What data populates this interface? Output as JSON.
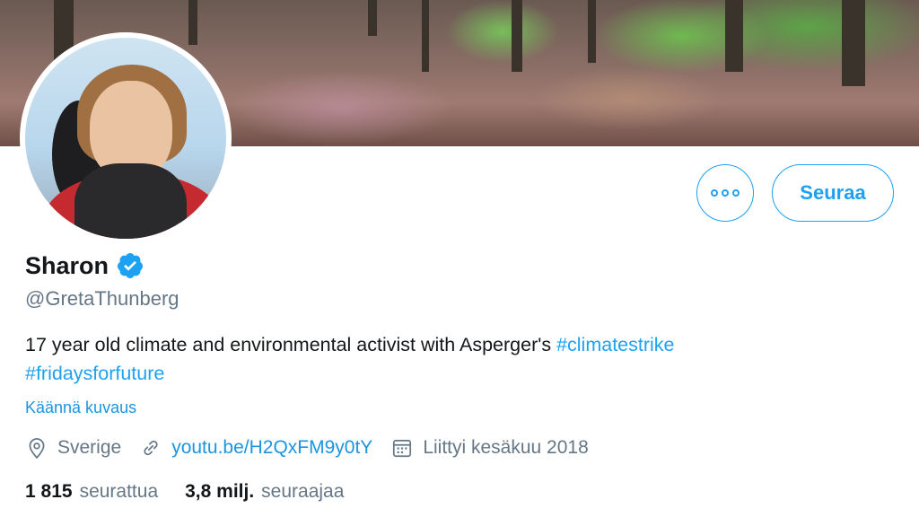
{
  "profile": {
    "name": "Sharon",
    "handle": "@GretaThunberg",
    "bio_text": "17 year old climate and environmental activist with Asperger's ",
    "hashtag_1": "#climatestrike",
    "hashtag_2": "#fridaysforfuture",
    "translate_label": "Käännä kuvaus",
    "location": "Sverige",
    "website": "youtu.be/H2QxFM9y0tY",
    "joined": "Liittyi kesäkuu 2018",
    "following_count": "1 815",
    "following_label": "seurattua",
    "followers_count": "3,8 milj.",
    "followers_label": "seuraajaa"
  },
  "actions": {
    "follow_label": "Seuraa",
    "more_icon": "more-icon"
  },
  "colors": {
    "accent": "#1da1f2",
    "secondary_text": "#657786"
  }
}
